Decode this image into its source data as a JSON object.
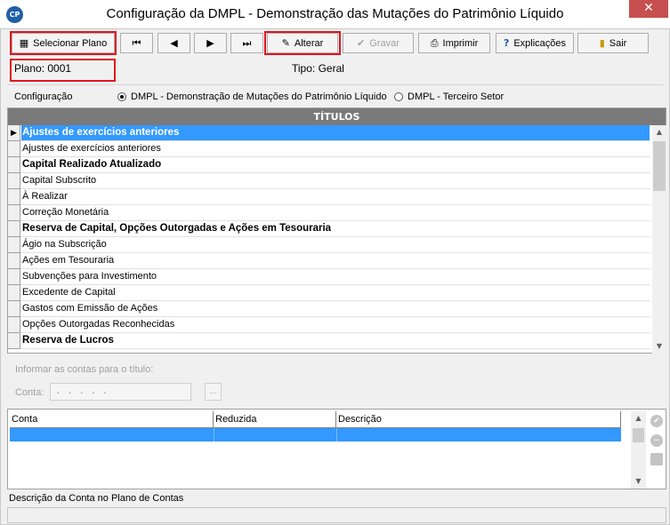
{
  "window": {
    "logo": "CP",
    "title": "Configuração da DMPL - Demonstração das Mutações do Patrimônio Líquido",
    "close": "✕"
  },
  "toolbar": {
    "selecionar_plano": "Selecionar Plano",
    "first": "⏮",
    "prev": "◀",
    "next": "▶",
    "last": "⏭",
    "alterar": "Alterar",
    "gravar": "Gravar",
    "imprimir": "Imprimir",
    "explicacoes": "Explicações",
    "sair": "Sair"
  },
  "plano": "Plano: 0001",
  "tipo": "Tipo:  Geral",
  "configuracao": {
    "label": "Configuração",
    "options": [
      {
        "label": "DMPL - Demonstração de Mutações do Patrimônio Líquido",
        "selected": true
      },
      {
        "label": "DMPL - Terceiro Setor",
        "selected": false
      }
    ]
  },
  "titulos_grid": {
    "header": "TÍTULOS",
    "rows": [
      {
        "text": "Ajustes de exercícios anteriores",
        "bold": true,
        "selected": true
      },
      {
        "text": "Ajustes de exercícios anteriores",
        "bold": false
      },
      {
        "text": "Capital Realizado Atualizado",
        "bold": true
      },
      {
        "text": "Capital Subscrito",
        "bold": false
      },
      {
        "text": "À Realizar",
        "bold": false
      },
      {
        "text": "Correção Monetária",
        "bold": false
      },
      {
        "text": "Reserva de Capital, Opções Outorgadas e Ações em Tesouraria",
        "bold": true
      },
      {
        "text": "Ágio na Subscrição",
        "bold": false
      },
      {
        "text": "Ações em Tesouraria",
        "bold": false
      },
      {
        "text": "Subvenções para Investimento",
        "bold": false
      },
      {
        "text": "Excedente de Capital",
        "bold": false
      },
      {
        "text": "Gastos com Emissão de Ações",
        "bold": false
      },
      {
        "text": "Opções Outorgadas Reconhecidas",
        "bold": false
      },
      {
        "text": "Reserva de Lucros",
        "bold": true
      }
    ]
  },
  "informar": {
    "label": "Informar as contas para o título:",
    "conta_label": "Conta:",
    "conta_mask": ". . . .   .",
    "lookup": "..."
  },
  "contas_grid": {
    "columns": [
      "Conta",
      "Reduzida",
      "Descrição"
    ]
  },
  "descricao_label": "Descrição da Conta no Plano de Contas",
  "colors": {
    "selection": "#3399ff",
    "header_bg": "#7a7a7a",
    "highlight": "#e0141e"
  }
}
